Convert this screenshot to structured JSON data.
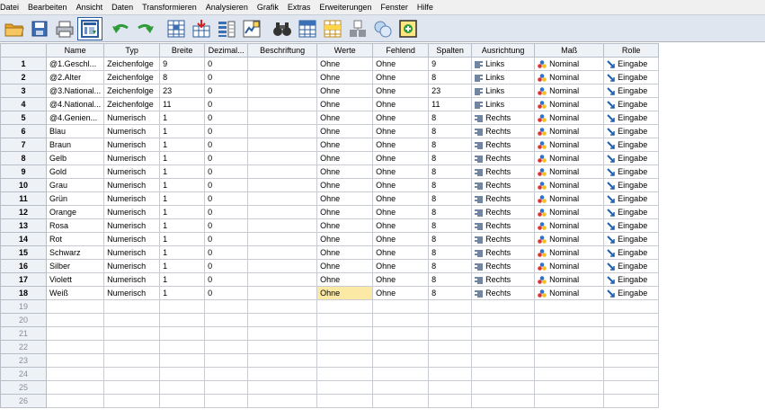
{
  "menu": [
    {
      "id": "datei",
      "label": "Datei"
    },
    {
      "id": "bearbeiten",
      "label": "Bearbeiten"
    },
    {
      "id": "ansicht",
      "label": "Ansicht"
    },
    {
      "id": "daten",
      "label": "Daten"
    },
    {
      "id": "transformieren",
      "label": "Transformieren"
    },
    {
      "id": "analysieren",
      "label": "Analysieren"
    },
    {
      "id": "grafik",
      "label": "Grafik"
    },
    {
      "id": "extras",
      "label": "Extras"
    },
    {
      "id": "erweiterungen",
      "label": "Erweiterungen"
    },
    {
      "id": "fenster",
      "label": "Fenster"
    },
    {
      "id": "hilfe",
      "label": "Hilfe"
    }
  ],
  "toolbar": [
    {
      "icon": "open-folder-icon"
    },
    {
      "icon": "save-icon"
    },
    {
      "icon": "print-icon"
    },
    {
      "icon": "recall-dialog-icon"
    },
    {
      "icon": "undo-icon"
    },
    {
      "icon": "redo-icon"
    },
    {
      "icon": "goto-case-icon"
    },
    {
      "icon": "goto-variable-icon"
    },
    {
      "icon": "variables-icon"
    },
    {
      "icon": "run-descriptives-icon"
    },
    {
      "icon": "find-binoculars-icon"
    },
    {
      "icon": "split-file-icon"
    },
    {
      "icon": "select-cases-icon"
    },
    {
      "icon": "weight-cases-icon"
    },
    {
      "icon": "value-labels-icon"
    },
    {
      "icon": "custom-sets-icon"
    }
  ],
  "columns": [
    "Name",
    "Typ",
    "Breite",
    "Dezimal...",
    "Beschriftung",
    "Werte",
    "Fehlend",
    "Spalten",
    "Ausrichtung",
    "Maß",
    "Rolle"
  ],
  "rows": [
    {
      "num": "1",
      "name": "@1.Geschl...",
      "typ": "Zeichenfolge",
      "breite": "9",
      "dezimal": "0",
      "beschriftung": "",
      "werte": "Ohne",
      "fehlend": "Ohne",
      "spalten": "9",
      "ausrichtung": "Links",
      "mass": "Nominal",
      "rolle": "Eingabe"
    },
    {
      "num": "2",
      "name": "@2.Alter",
      "typ": "Zeichenfolge",
      "breite": "8",
      "dezimal": "0",
      "beschriftung": "",
      "werte": "Ohne",
      "fehlend": "Ohne",
      "spalten": "8",
      "ausrichtung": "Links",
      "mass": "Nominal",
      "rolle": "Eingabe"
    },
    {
      "num": "3",
      "name": "@3.National...",
      "typ": "Zeichenfolge",
      "breite": "23",
      "dezimal": "0",
      "beschriftung": "",
      "werte": "Ohne",
      "fehlend": "Ohne",
      "spalten": "23",
      "ausrichtung": "Links",
      "mass": "Nominal",
      "rolle": "Eingabe"
    },
    {
      "num": "4",
      "name": "@4.National...",
      "typ": "Zeichenfolge",
      "breite": "11",
      "dezimal": "0",
      "beschriftung": "",
      "werte": "Ohne",
      "fehlend": "Ohne",
      "spalten": "11",
      "ausrichtung": "Links",
      "mass": "Nominal",
      "rolle": "Eingabe"
    },
    {
      "num": "5",
      "name": "@4.Genien...",
      "typ": "Numerisch",
      "breite": "1",
      "dezimal": "0",
      "beschriftung": "",
      "werte": "Ohne",
      "fehlend": "Ohne",
      "spalten": "8",
      "ausrichtung": "Rechts",
      "mass": "Nominal",
      "rolle": "Eingabe"
    },
    {
      "num": "6",
      "name": "Blau",
      "typ": "Numerisch",
      "breite": "1",
      "dezimal": "0",
      "beschriftung": "",
      "werte": "Ohne",
      "fehlend": "Ohne",
      "spalten": "8",
      "ausrichtung": "Rechts",
      "mass": "Nominal",
      "rolle": "Eingabe"
    },
    {
      "num": "7",
      "name": "Braun",
      "typ": "Numerisch",
      "breite": "1",
      "dezimal": "0",
      "beschriftung": "",
      "werte": "Ohne",
      "fehlend": "Ohne",
      "spalten": "8",
      "ausrichtung": "Rechts",
      "mass": "Nominal",
      "rolle": "Eingabe"
    },
    {
      "num": "8",
      "name": "Gelb",
      "typ": "Numerisch",
      "breite": "1",
      "dezimal": "0",
      "beschriftung": "",
      "werte": "Ohne",
      "fehlend": "Ohne",
      "spalten": "8",
      "ausrichtung": "Rechts",
      "mass": "Nominal",
      "rolle": "Eingabe"
    },
    {
      "num": "9",
      "name": "Gold",
      "typ": "Numerisch",
      "breite": "1",
      "dezimal": "0",
      "beschriftung": "",
      "werte": "Ohne",
      "fehlend": "Ohne",
      "spalten": "8",
      "ausrichtung": "Rechts",
      "mass": "Nominal",
      "rolle": "Eingabe"
    },
    {
      "num": "10",
      "name": "Grau",
      "typ": "Numerisch",
      "breite": "1",
      "dezimal": "0",
      "beschriftung": "",
      "werte": "Ohne",
      "fehlend": "Ohne",
      "spalten": "8",
      "ausrichtung": "Rechts",
      "mass": "Nominal",
      "rolle": "Eingabe"
    },
    {
      "num": "11",
      "name": "Grün",
      "typ": "Numerisch",
      "breite": "1",
      "dezimal": "0",
      "beschriftung": "",
      "werte": "Ohne",
      "fehlend": "Ohne",
      "spalten": "8",
      "ausrichtung": "Rechts",
      "mass": "Nominal",
      "rolle": "Eingabe"
    },
    {
      "num": "12",
      "name": "Orange",
      "typ": "Numerisch",
      "breite": "1",
      "dezimal": "0",
      "beschriftung": "",
      "werte": "Ohne",
      "fehlend": "Ohne",
      "spalten": "8",
      "ausrichtung": "Rechts",
      "mass": "Nominal",
      "rolle": "Eingabe"
    },
    {
      "num": "13",
      "name": "Rosa",
      "typ": "Numerisch",
      "breite": "1",
      "dezimal": "0",
      "beschriftung": "",
      "werte": "Ohne",
      "fehlend": "Ohne",
      "spalten": "8",
      "ausrichtung": "Rechts",
      "mass": "Nominal",
      "rolle": "Eingabe"
    },
    {
      "num": "14",
      "name": "Rot",
      "typ": "Numerisch",
      "breite": "1",
      "dezimal": "0",
      "beschriftung": "",
      "werte": "Ohne",
      "fehlend": "Ohne",
      "spalten": "8",
      "ausrichtung": "Rechts",
      "mass": "Nominal",
      "rolle": "Eingabe"
    },
    {
      "num": "15",
      "name": "Schwarz",
      "typ": "Numerisch",
      "breite": "1",
      "dezimal": "0",
      "beschriftung": "",
      "werte": "Ohne",
      "fehlend": "Ohne",
      "spalten": "8",
      "ausrichtung": "Rechts",
      "mass": "Nominal",
      "rolle": "Eingabe"
    },
    {
      "num": "16",
      "name": "Silber",
      "typ": "Numerisch",
      "breite": "1",
      "dezimal": "0",
      "beschriftung": "",
      "werte": "Ohne",
      "fehlend": "Ohne",
      "spalten": "8",
      "ausrichtung": "Rechts",
      "mass": "Nominal",
      "rolle": "Eingabe"
    },
    {
      "num": "17",
      "name": "Violett",
      "typ": "Numerisch",
      "breite": "1",
      "dezimal": "0",
      "beschriftung": "",
      "werte": "Ohne",
      "fehlend": "Ohne",
      "spalten": "8",
      "ausrichtung": "Rechts",
      "mass": "Nominal",
      "rolle": "Eingabe"
    },
    {
      "num": "18",
      "name": "Weiß",
      "typ": "Numerisch",
      "breite": "1",
      "dezimal": "0",
      "beschriftung": "",
      "werte": "Ohne",
      "fehlend": "Ohne",
      "spalten": "8",
      "ausrichtung": "Rechts",
      "mass": "Nominal",
      "rolle": "Eingabe"
    }
  ],
  "empty_rows": [
    "19",
    "20",
    "21",
    "22",
    "23",
    "24",
    "25",
    "26"
  ],
  "selected_cell": {
    "row": "18",
    "column": "Werte"
  },
  "colors": {
    "selected": "#fce9a6",
    "header": "#eef1f5",
    "toolbar": "#dfe6f0",
    "menubar": "#f0f0f0"
  }
}
